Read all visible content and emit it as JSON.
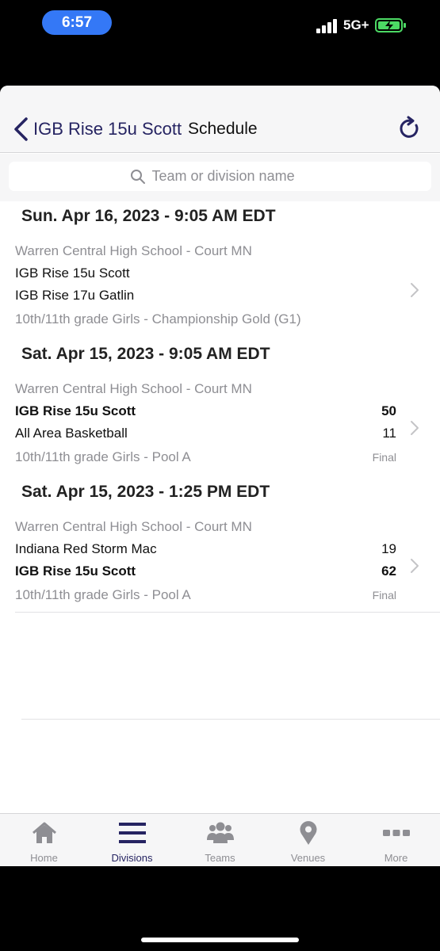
{
  "status_bar": {
    "time": "6:57",
    "network": "5G+"
  },
  "navbar": {
    "back_label": "IGB Rise 15u Scott",
    "title": "Schedule"
  },
  "search": {
    "placeholder": "Team or division name"
  },
  "days": [
    {
      "header": "Sun. Apr 16, 2023 - 9:05 AM EDT"
    },
    {
      "header": "Sat. Apr 15, 2023 - 9:05 AM EDT"
    },
    {
      "header": "Sat. Apr 15, 2023 - 1:25 PM EDT"
    }
  ],
  "games": [
    {
      "venue": "Warren Central High School - Court MN",
      "team1": "IGB Rise 15u Scott",
      "team2": "IGB Rise 17u Gatlin",
      "division": "10th/11th grade Girls - Championship Gold (G1)"
    },
    {
      "venue": "Warren Central High School - Court MN",
      "team1": "IGB Rise 15u Scott",
      "score1": "50",
      "team2": "All Area Basketball",
      "score2": "11",
      "division": "10th/11th grade Girls - Pool A",
      "status": "Final"
    },
    {
      "venue": "Warren Central High School - Court MN",
      "team1": "Indiana Red Storm Mac",
      "score1": "19",
      "team2": "IGB Rise 15u Scott",
      "score2": "62",
      "division": "10th/11th grade Girls - Pool A",
      "status": "Final"
    }
  ],
  "tabs": [
    {
      "label": "Home",
      "icon": "house-icon"
    },
    {
      "label": "Divisions",
      "icon": "list-icon",
      "active": true
    },
    {
      "label": "Teams",
      "icon": "people-icon"
    },
    {
      "label": "Venues",
      "icon": "map-pin-icon"
    },
    {
      "label": "More",
      "icon": "ellipsis-icon"
    }
  ],
  "colors": {
    "accent": "#262462",
    "time_pill": "#3478f6",
    "battery": "#4cd964",
    "secondary_text": "#8e8e93"
  }
}
